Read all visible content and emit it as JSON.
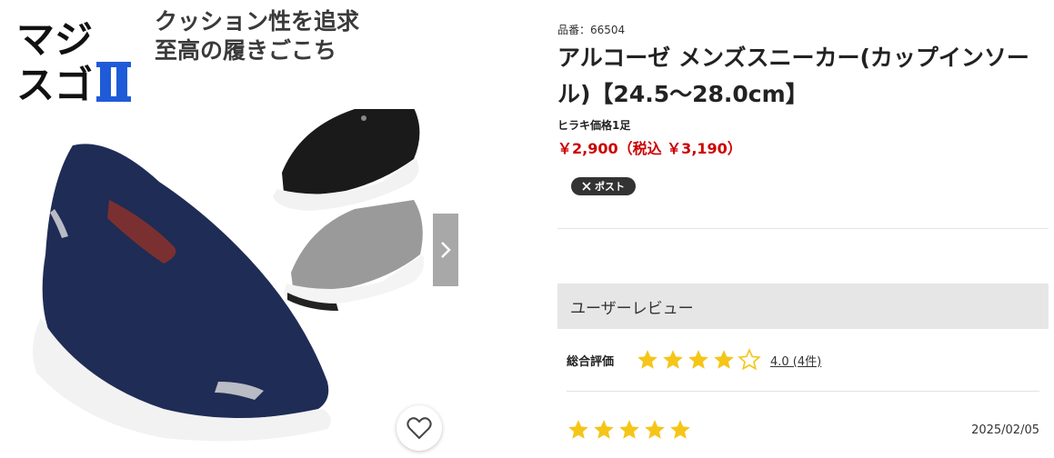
{
  "gallery": {
    "brand_logo_text": "マジスゴⅡ",
    "promo_line1": "クッション性を追求",
    "promo_line2": "至高の履きごこち",
    "next_icon": "chevron-right-icon",
    "favorite_icon": "heart-icon"
  },
  "product": {
    "sku": "品番：66504",
    "title": "アルコーゼ メンズスニーカー(カップインソール)【24.5～28.0cm】",
    "price_label": "ヒラキ価格1足",
    "price": "￥2,900（税込 ￥3,190）",
    "share_label": "ポスト",
    "share_icon": "x-logo-icon"
  },
  "reviews": {
    "heading": "ユーザーレビュー",
    "overall_label": "総合評価",
    "overall_rating": 4.0,
    "overall_link": "4.0 (4件)",
    "items": [
      {
        "rating": 5,
        "date": "2025/02/05"
      }
    ]
  },
  "colors": {
    "price": "#cc0000",
    "star": "#f5c518",
    "review_header_bg": "#e6e6e6",
    "logo_blue": "#1f5bd8"
  }
}
